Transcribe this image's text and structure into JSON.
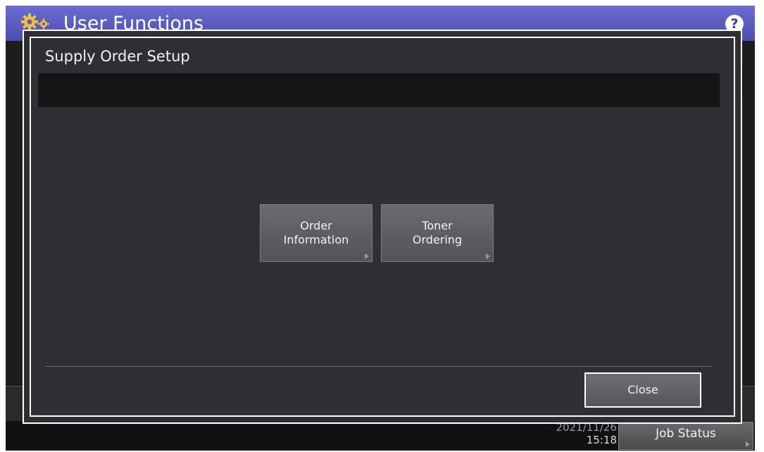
{
  "app": {
    "title": "User Functions",
    "help_label": "?"
  },
  "footer": {
    "date": "2021/11/26",
    "time": "15:18",
    "job_status_label": "Job Status"
  },
  "dialog": {
    "title": "Supply Order Setup",
    "buttons": [
      {
        "label": "Order\nInformation"
      },
      {
        "label": "Toner\nOrdering"
      }
    ],
    "close_label": "Close"
  }
}
